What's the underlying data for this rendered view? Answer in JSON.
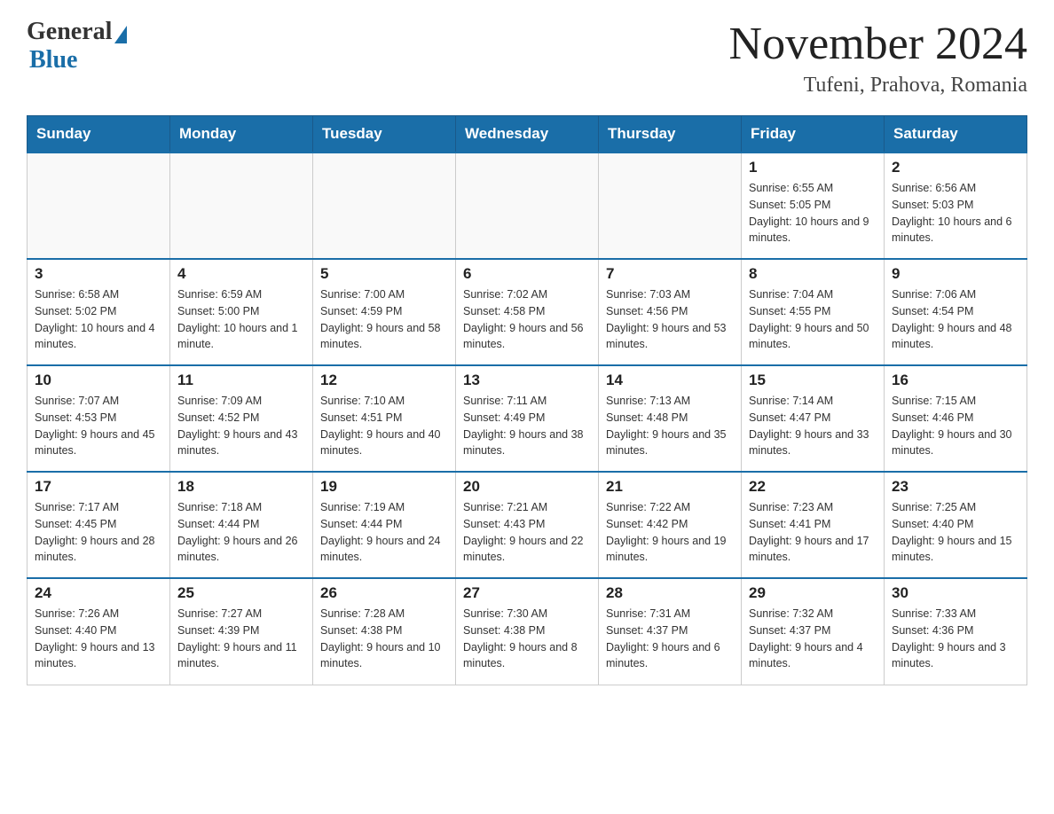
{
  "header": {
    "logo_general": "General",
    "logo_blue": "Blue",
    "month_title": "November 2024",
    "location": "Tufeni, Prahova, Romania"
  },
  "days_of_week": [
    "Sunday",
    "Monday",
    "Tuesday",
    "Wednesday",
    "Thursday",
    "Friday",
    "Saturday"
  ],
  "weeks": [
    [
      {
        "day": "",
        "info": ""
      },
      {
        "day": "",
        "info": ""
      },
      {
        "day": "",
        "info": ""
      },
      {
        "day": "",
        "info": ""
      },
      {
        "day": "",
        "info": ""
      },
      {
        "day": "1",
        "info": "Sunrise: 6:55 AM\nSunset: 5:05 PM\nDaylight: 10 hours and 9 minutes."
      },
      {
        "day": "2",
        "info": "Sunrise: 6:56 AM\nSunset: 5:03 PM\nDaylight: 10 hours and 6 minutes."
      }
    ],
    [
      {
        "day": "3",
        "info": "Sunrise: 6:58 AM\nSunset: 5:02 PM\nDaylight: 10 hours and 4 minutes."
      },
      {
        "day": "4",
        "info": "Sunrise: 6:59 AM\nSunset: 5:00 PM\nDaylight: 10 hours and 1 minute."
      },
      {
        "day": "5",
        "info": "Sunrise: 7:00 AM\nSunset: 4:59 PM\nDaylight: 9 hours and 58 minutes."
      },
      {
        "day": "6",
        "info": "Sunrise: 7:02 AM\nSunset: 4:58 PM\nDaylight: 9 hours and 56 minutes."
      },
      {
        "day": "7",
        "info": "Sunrise: 7:03 AM\nSunset: 4:56 PM\nDaylight: 9 hours and 53 minutes."
      },
      {
        "day": "8",
        "info": "Sunrise: 7:04 AM\nSunset: 4:55 PM\nDaylight: 9 hours and 50 minutes."
      },
      {
        "day": "9",
        "info": "Sunrise: 7:06 AM\nSunset: 4:54 PM\nDaylight: 9 hours and 48 minutes."
      }
    ],
    [
      {
        "day": "10",
        "info": "Sunrise: 7:07 AM\nSunset: 4:53 PM\nDaylight: 9 hours and 45 minutes."
      },
      {
        "day": "11",
        "info": "Sunrise: 7:09 AM\nSunset: 4:52 PM\nDaylight: 9 hours and 43 minutes."
      },
      {
        "day": "12",
        "info": "Sunrise: 7:10 AM\nSunset: 4:51 PM\nDaylight: 9 hours and 40 minutes."
      },
      {
        "day": "13",
        "info": "Sunrise: 7:11 AM\nSunset: 4:49 PM\nDaylight: 9 hours and 38 minutes."
      },
      {
        "day": "14",
        "info": "Sunrise: 7:13 AM\nSunset: 4:48 PM\nDaylight: 9 hours and 35 minutes."
      },
      {
        "day": "15",
        "info": "Sunrise: 7:14 AM\nSunset: 4:47 PM\nDaylight: 9 hours and 33 minutes."
      },
      {
        "day": "16",
        "info": "Sunrise: 7:15 AM\nSunset: 4:46 PM\nDaylight: 9 hours and 30 minutes."
      }
    ],
    [
      {
        "day": "17",
        "info": "Sunrise: 7:17 AM\nSunset: 4:45 PM\nDaylight: 9 hours and 28 minutes."
      },
      {
        "day": "18",
        "info": "Sunrise: 7:18 AM\nSunset: 4:44 PM\nDaylight: 9 hours and 26 minutes."
      },
      {
        "day": "19",
        "info": "Sunrise: 7:19 AM\nSunset: 4:44 PM\nDaylight: 9 hours and 24 minutes."
      },
      {
        "day": "20",
        "info": "Sunrise: 7:21 AM\nSunset: 4:43 PM\nDaylight: 9 hours and 22 minutes."
      },
      {
        "day": "21",
        "info": "Sunrise: 7:22 AM\nSunset: 4:42 PM\nDaylight: 9 hours and 19 minutes."
      },
      {
        "day": "22",
        "info": "Sunrise: 7:23 AM\nSunset: 4:41 PM\nDaylight: 9 hours and 17 minutes."
      },
      {
        "day": "23",
        "info": "Sunrise: 7:25 AM\nSunset: 4:40 PM\nDaylight: 9 hours and 15 minutes."
      }
    ],
    [
      {
        "day": "24",
        "info": "Sunrise: 7:26 AM\nSunset: 4:40 PM\nDaylight: 9 hours and 13 minutes."
      },
      {
        "day": "25",
        "info": "Sunrise: 7:27 AM\nSunset: 4:39 PM\nDaylight: 9 hours and 11 minutes."
      },
      {
        "day": "26",
        "info": "Sunrise: 7:28 AM\nSunset: 4:38 PM\nDaylight: 9 hours and 10 minutes."
      },
      {
        "day": "27",
        "info": "Sunrise: 7:30 AM\nSunset: 4:38 PM\nDaylight: 9 hours and 8 minutes."
      },
      {
        "day": "28",
        "info": "Sunrise: 7:31 AM\nSunset: 4:37 PM\nDaylight: 9 hours and 6 minutes."
      },
      {
        "day": "29",
        "info": "Sunrise: 7:32 AM\nSunset: 4:37 PM\nDaylight: 9 hours and 4 minutes."
      },
      {
        "day": "30",
        "info": "Sunrise: 7:33 AM\nSunset: 4:36 PM\nDaylight: 9 hours and 3 minutes."
      }
    ]
  ]
}
